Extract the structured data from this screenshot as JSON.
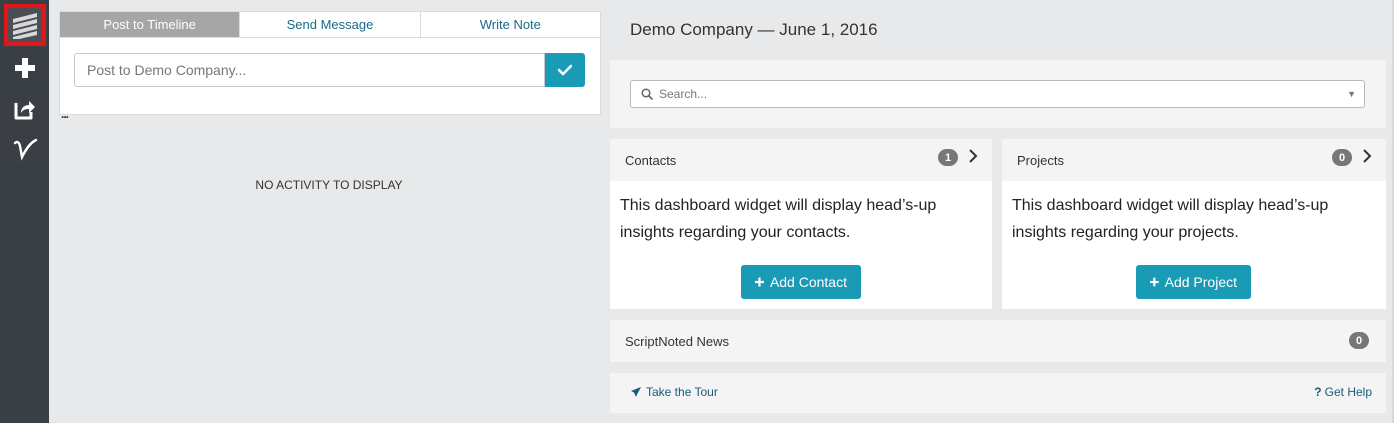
{
  "sidebar": {
    "items": [
      {
        "icon": "logo-icon"
      },
      {
        "icon": "plus-icon"
      },
      {
        "icon": "share-icon"
      },
      {
        "icon": "v-signature-icon"
      }
    ],
    "accent_color": "#e0161b"
  },
  "left": {
    "tabs": [
      {
        "label": "Post to Timeline",
        "active": true
      },
      {
        "label": "Send Message",
        "active": false
      },
      {
        "label": "Write Note",
        "active": false
      }
    ],
    "post_placeholder": "Post to Demo Company...",
    "ellipsis": "...",
    "empty_message": "NO ACTIVITY TO DISPLAY"
  },
  "right": {
    "title": "Demo Company — June 1, 2016",
    "search_placeholder": "Search...",
    "contacts": {
      "title": "Contacts",
      "count": "1",
      "body": "This dashboard widget will display head’s-up insights regarding your contacts.",
      "button_label": "Add Contact"
    },
    "projects": {
      "title": "Projects",
      "count": "0",
      "body": "This dashboard widget will display head’s-up insights regarding your projects.",
      "button_label": "Add Project"
    },
    "news": {
      "title": "ScriptNoted News",
      "count": "0"
    },
    "footer": {
      "tour_label": "Take the Tour",
      "help_label": "Get Help"
    }
  },
  "colors": {
    "primary": "#1a9bb5",
    "sidebar_bg": "#3a3f45",
    "badge": "#777777"
  }
}
